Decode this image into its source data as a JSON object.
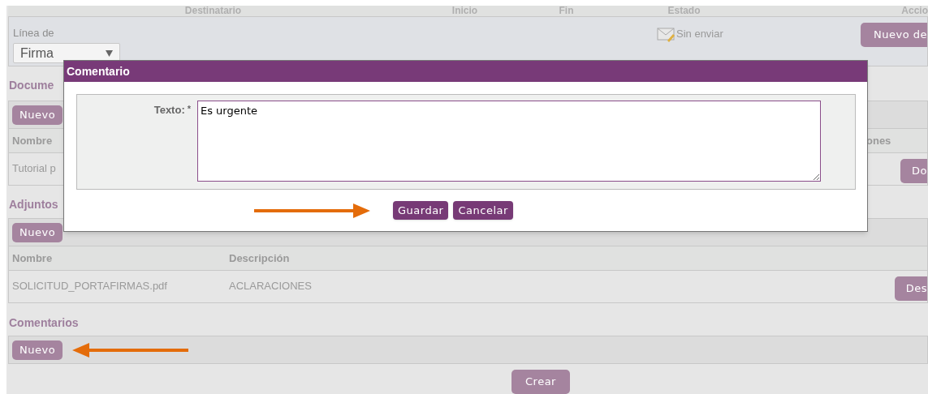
{
  "signers_table": {
    "columns": [
      "Destinatario",
      "Inicio",
      "Fin",
      "Estado",
      "Accio"
    ],
    "row": {
      "line_label": "Línea de",
      "line_select": "Firma",
      "status": "Sin enviar",
      "action": "Nuevo de"
    }
  },
  "sections": [
    {
      "title": "Docume",
      "new_button": "Nuevo",
      "columns": [
        "Nombre"
      ],
      "actions_column": "ones",
      "rows": [
        {
          "cells": [
            "Tutorial p"
          ],
          "action": "Do"
        }
      ]
    },
    {
      "title": "Adjuntos",
      "new_button": "Nuevo",
      "columns": [
        "Nombre",
        "Descripción"
      ],
      "rows": [
        {
          "cells": [
            "SOLICITUD_PORTAFIRMAS.pdf",
            "ACLARACIONES"
          ],
          "action": "Des"
        }
      ]
    },
    {
      "title": "Comentarios",
      "new_button": "Nuevo"
    }
  ],
  "create_button": "Crear",
  "dialog": {
    "title": "Comentario",
    "field_label": "Texto:",
    "required_mark": "*",
    "value": "Es urgente",
    "buttons": [
      "Guardar",
      "Cancelar"
    ]
  }
}
